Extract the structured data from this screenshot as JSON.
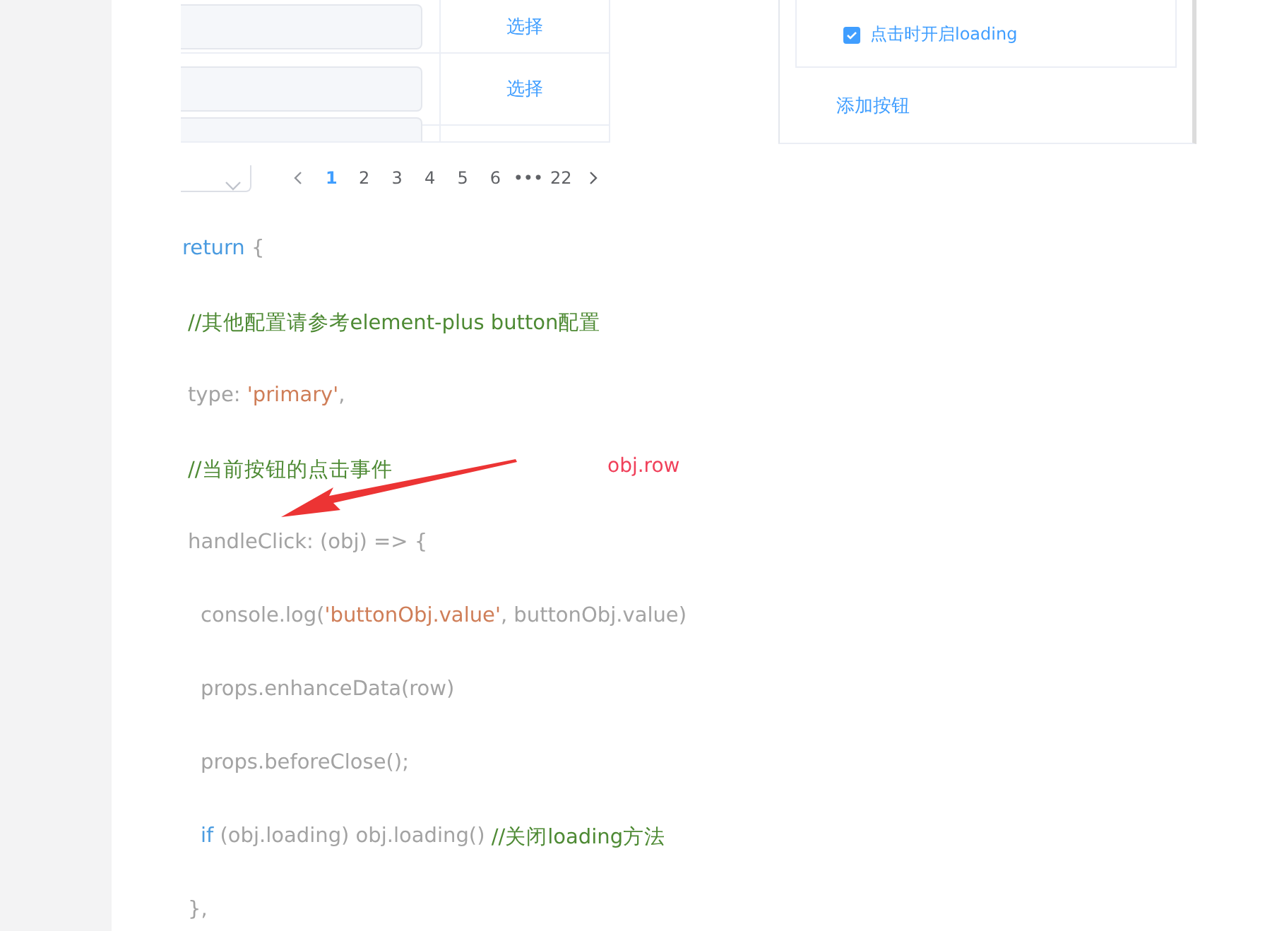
{
  "table": {
    "rows": [
      {
        "action": "选择"
      },
      {
        "action": "选择"
      },
      {
        "action": ""
      }
    ]
  },
  "pagination": {
    "pages": [
      {
        "label": "1",
        "selected": true
      },
      {
        "label": "2",
        "selected": false
      },
      {
        "label": "3",
        "selected": false
      },
      {
        "label": "4",
        "selected": false
      },
      {
        "label": "5",
        "selected": false
      },
      {
        "label": "6",
        "selected": false
      },
      {
        "label": "•••",
        "selected": false
      },
      {
        "label": "22",
        "selected": false
      }
    ]
  },
  "panel": {
    "checkboxes": [
      {
        "label": "点击时开启loading",
        "checked": true
      }
    ],
    "add_button": "添加按钮"
  },
  "code": [
    {
      "tokens": [
        {
          "kind": "keyword",
          "text": "return"
        },
        {
          "kind": "plain",
          "text": " {"
        }
      ],
      "children": [
        {
          "tokens": [
            {
              "kind": "comment",
              "text": "//其他配置请参考element-plus button配置"
            }
          ]
        },
        {
          "tokens": [
            {
              "kind": "plain",
              "text": "type: "
            },
            {
              "kind": "string",
              "text": "'primary'"
            },
            {
              "kind": "plain",
              "text": ","
            }
          ]
        },
        {
          "tokens": [
            {
              "kind": "comment",
              "text": "//当前按钮的点击事件"
            }
          ]
        },
        {
          "tokens": [
            {
              "kind": "plain",
              "text": "handleClick: (obj) => {"
            }
          ],
          "children": [
            {
              "tokens": [
                {
                  "kind": "plain",
                  "text": "console.log("
                },
                {
                  "kind": "string",
                  "text": "'buttonObj.value'"
                },
                {
                  "kind": "plain",
                  "text": ", buttonObj.value)"
                }
              ]
            },
            {
              "tokens": [
                {
                  "kind": "plain",
                  "text": "props.enhanceData(row)"
                }
              ]
            },
            {
              "tokens": [
                {
                  "kind": "plain",
                  "text": "props.beforeClose();"
                }
              ]
            },
            {
              "tokens": [
                {
                  "kind": "keyword",
                  "text": "if"
                },
                {
                  "kind": "plain",
                  "text": " (obj.loading) obj.loading() "
                },
                {
                  "kind": "comment",
                  "text": "//关闭loading方法"
                }
              ]
            }
          ]
        },
        {
          "tokens": [
            {
              "kind": "plain",
              "text": "},"
            }
          ]
        }
      ]
    }
  ],
  "annotation": {
    "label": "obj.row"
  }
}
